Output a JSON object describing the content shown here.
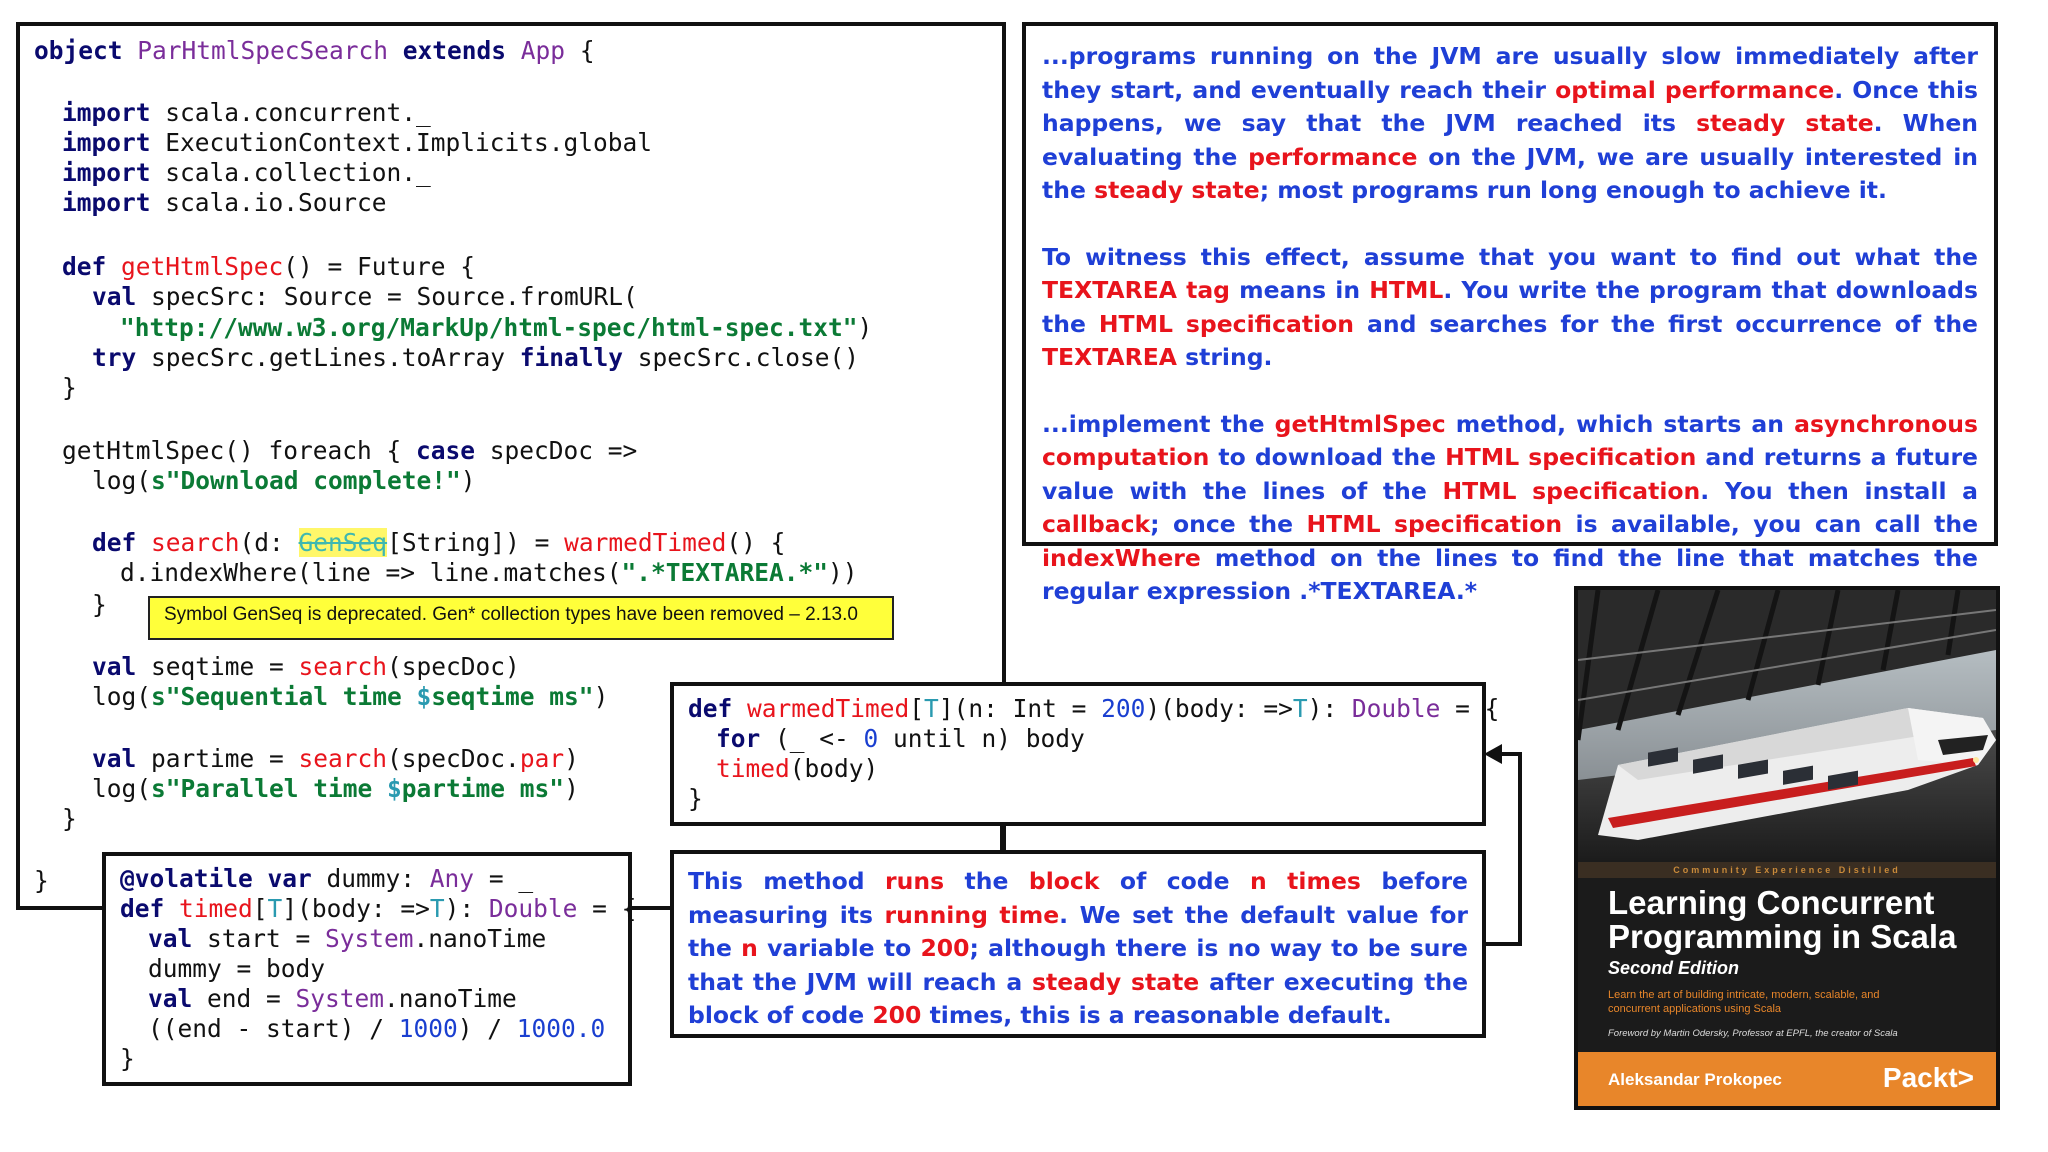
{
  "main_code": {
    "l1": [
      "object ",
      "ParHtmlSpecSearch",
      " extends ",
      "App",
      " {"
    ],
    "l3": [
      "import",
      " scala.concurrent._"
    ],
    "l4": [
      "import",
      " ExecutionContext.Implicits.global"
    ],
    "l5": [
      "import",
      " scala.collection._"
    ],
    "l6": [
      "import",
      " scala.io.Source"
    ],
    "l8": [
      "def ",
      "getHtmlSpec",
      "() = Future {"
    ],
    "l9": [
      "val",
      " specSrc: Source = Source.fromURL("
    ],
    "l10": "\"http://www.w3.org/MarkUp/html-spec/html-spec.txt\"",
    "l10b": ")",
    "l11": [
      "try",
      " specSrc.getLines.toArray ",
      "finally",
      " specSrc.close()"
    ],
    "l12": "}",
    "l14": [
      "getHtmlSpec() foreach { ",
      "case",
      " specDoc =>"
    ],
    "l15": [
      "log(",
      "s\"Download complete!\"",
      ")"
    ],
    "l17": [
      "def ",
      "search",
      "(d: ",
      "GenSeq",
      "[String]) = ",
      "warmedTimed",
      "() {"
    ],
    "l18": [
      "d.indexWhere(line => line.matches(",
      "\".*TEXTAREA.*\"",
      "))"
    ],
    "l19": "}",
    "l21": [
      "val",
      " seqtime = ",
      "search",
      "(specDoc)"
    ],
    "l22": [
      "log(",
      "s\"Sequential time ",
      "$",
      "seqtime ms\"",
      ")"
    ],
    "l24": [
      "val",
      " partime = ",
      "search",
      "(specDoc.",
      "par",
      ")"
    ],
    "l25": [
      "log(",
      "s\"Parallel time ",
      "$",
      "partime ms\"",
      ")"
    ],
    "l26": "}",
    "l28": "}"
  },
  "warning": "Symbol GenSeq is deprecated. Gen* collection types have been removed – 2.13.0",
  "warmed_code": {
    "l1": [
      "def ",
      "warmedTimed",
      "[",
      "T",
      "](n: Int = ",
      "200",
      ")(body: =>",
      "T",
      "): ",
      "Double",
      " = {"
    ],
    "l2": [
      "for",
      " (_ <- ",
      "0",
      " until n) body"
    ],
    "l3": [
      "timed",
      "(body)"
    ],
    "l4": "}"
  },
  "timed_code": {
    "l1": [
      "@volatile ",
      "var",
      " dummy: ",
      "Any",
      " = _"
    ],
    "l2": [
      "def ",
      "timed",
      "[",
      "T",
      "](body: =>",
      "T",
      "): ",
      "Double",
      " = {"
    ],
    "l3": [
      "val",
      " start = ",
      "System",
      ".nanoTime"
    ],
    "l4": "dummy = body",
    "l5": [
      "val",
      " end = ",
      "System",
      ".nanoTime"
    ],
    "l6": [
      "((end - start) / ",
      "1000",
      ") / ",
      "1000.0"
    ],
    "l7": "}"
  },
  "jvm_text": {
    "p1": [
      "...programs running on the JVM are usually slow immediately after they start, and eventually reach their ",
      "optimal performance",
      ". Once this happens, we say that the JVM reached its ",
      "steady state",
      ". When evaluating the ",
      "performance",
      " on the JVM, we are usually interested in the ",
      "steady state",
      "; most programs run long enough to achieve it."
    ],
    "p2": [
      "To witness this effect, assume that you want to find out what the ",
      "TEXTAREA tag",
      " means in ",
      "HTML",
      ". You write the program that downloads the ",
      "HTML specification",
      " and searches for the first occurrence of the ",
      "TEXTAREA",
      " string."
    ],
    "p3": [
      "...implement the ",
      "getHtmlSpec",
      " method, which starts an ",
      "asynchronous computation",
      " to download the ",
      "HTML specification",
      " and returns a future value with the lines of the ",
      "HTML specification",
      ". You then install a ",
      "callback",
      "; once the ",
      "HTML specification",
      " is available, you can call the ",
      "indexWhere",
      " method on the lines to find the line that matches the regular expression .*TEXTAREA.*"
    ]
  },
  "method_text": [
    "This method ",
    "runs",
    " the ",
    "block",
    " of code ",
    "n times",
    " before measuring its ",
    "running time",
    ". We set the default value for the ",
    "n",
    " variable to ",
    "200",
    "; although there is no way to be sure that the JVM will reach a ",
    "steady state",
    " after executing the block of code ",
    "200",
    " times, this is a reasonable default."
  ],
  "book": {
    "tagline": "Community  Experience  Distilled",
    "title_line1": "Learning Concurrent",
    "title_line2": "Programming in Scala",
    "edition": "Second Edition",
    "blurb_line1": "Learn the art of building intricate, modern, scalable, and",
    "blurb_line2": "concurrent applications using Scala",
    "foreword": "Foreword by Martin Odersky, Professor at EPFL, the creator of Scala",
    "author": "Aleksandar Prokopec",
    "publisher": "Packt>"
  },
  "colors": {
    "text_blue": "#1f3fd6",
    "text_red": "#e8141c",
    "warning_bg": "#ffff3a",
    "book_orange": "#e8862a"
  }
}
